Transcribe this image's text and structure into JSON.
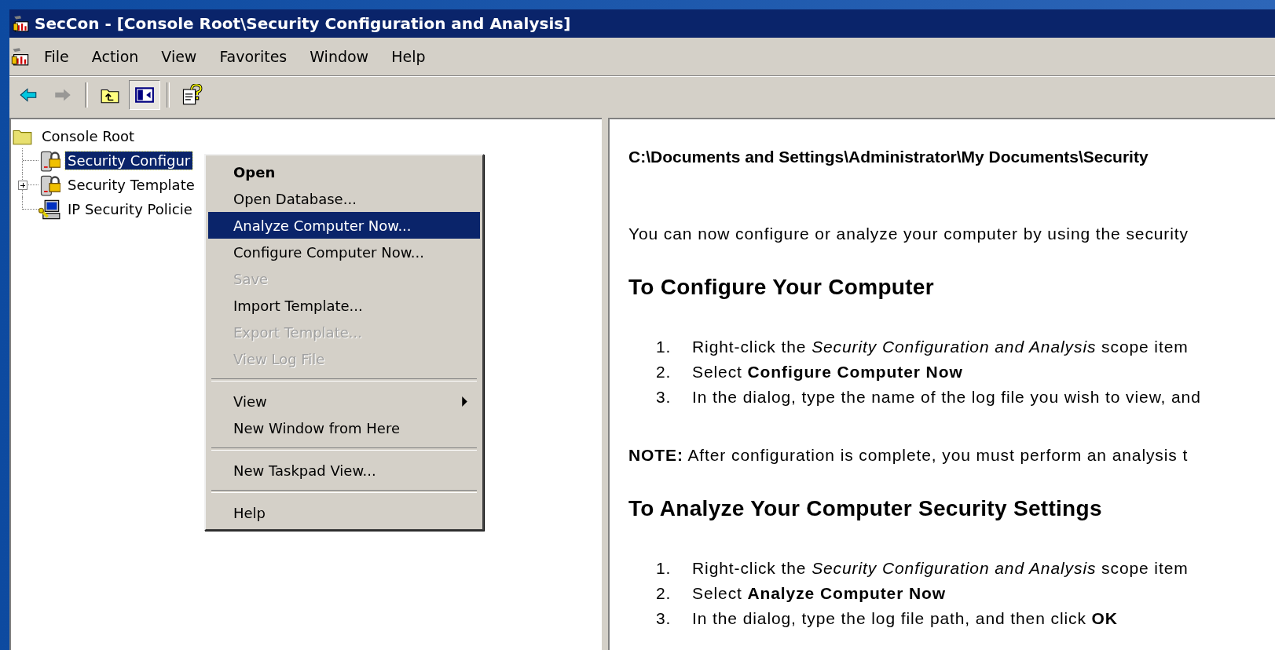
{
  "window": {
    "title": "SecCon - [Console Root\\Security Configuration and Analysis]"
  },
  "menu_bar": [
    "File",
    "Action",
    "View",
    "Favorites",
    "Window",
    "Help"
  ],
  "toolbar": {
    "groups": [
      [
        {
          "disabled": false,
          "pressed": false
        },
        {
          "disabled": true,
          "pressed": false
        }
      ],
      [
        {
          "disabled": false,
          "pressed": false
        },
        {
          "disabled": false,
          "pressed": true
        }
      ],
      [
        {
          "disabled": false,
          "pressed": false
        }
      ]
    ]
  },
  "tree": {
    "label": "Console Root",
    "expanded": true,
    "children": [
      {
        "label": "Security Configur",
        "kind": "leaf",
        "selected": true
      },
      {
        "label": "Security Template",
        "kind": "collapsed",
        "selected": false
      },
      {
        "label": "IP Security Policie",
        "kind": "leaf",
        "selected": false
      }
    ]
  },
  "context_menu": [
    {
      "kind": "item",
      "label": "Open",
      "default": true,
      "disabled": false,
      "selected": false,
      "submenu": false
    },
    {
      "kind": "item",
      "label": "Open Database...",
      "default": false,
      "disabled": false,
      "selected": false,
      "submenu": false
    },
    {
      "kind": "item",
      "label": "Analyze Computer Now...",
      "default": false,
      "disabled": false,
      "selected": true,
      "submenu": false
    },
    {
      "kind": "item",
      "label": "Configure Computer Now...",
      "default": false,
      "disabled": false,
      "selected": false,
      "submenu": false
    },
    {
      "kind": "item",
      "label": "Save",
      "default": false,
      "disabled": true,
      "selected": false,
      "submenu": false
    },
    {
      "kind": "item",
      "label": "Import Template...",
      "default": false,
      "disabled": false,
      "selected": false,
      "submenu": false
    },
    {
      "kind": "item",
      "label": "Export Template...",
      "default": false,
      "disabled": true,
      "selected": false,
      "submenu": false
    },
    {
      "kind": "item",
      "label": "View Log File",
      "default": false,
      "disabled": true,
      "selected": false,
      "submenu": false
    },
    {
      "kind": "separator"
    },
    {
      "kind": "item",
      "label": "View",
      "default": false,
      "disabled": false,
      "selected": false,
      "submenu": true
    },
    {
      "kind": "item",
      "label": "New Window from Here",
      "default": false,
      "disabled": false,
      "selected": false,
      "submenu": false
    },
    {
      "kind": "separator"
    },
    {
      "kind": "item",
      "label": "New Taskpad View...",
      "default": false,
      "disabled": false,
      "selected": false,
      "submenu": false
    },
    {
      "kind": "separator"
    },
    {
      "kind": "item",
      "label": "Help",
      "default": false,
      "disabled": false,
      "selected": false,
      "submenu": false
    }
  ],
  "result_pane": {
    "path": "C:\\Documents and Settings\\Administrator\\My Documents\\Security",
    "intro": "You can now configure or analyze your computer by using the security",
    "sections": [
      {
        "heading": "To Configure Your Computer",
        "steps": [
          {
            "number": "1.",
            "text": "Right-click the *Security Configuration and Analysis* scope item"
          },
          {
            "number": "2.",
            "text": "Select **Configure Computer Now**"
          },
          {
            "number": "3.",
            "text": "In the dialog, type the name of the log file you wish to view, and"
          }
        ],
        "note": "**NOTE:** After configuration is complete, you must perform an analysis t"
      },
      {
        "heading": "To Analyze Your Computer Security Settings",
        "steps": [
          {
            "number": "1.",
            "text": "Right-click the *Security Configuration and Analysis* scope item"
          },
          {
            "number": "2.",
            "text": "Select **Analyze Computer Now**"
          },
          {
            "number": "3.",
            "text": "In the dialog, type the log file path, and then click **OK**"
          }
        ]
      }
    ]
  }
}
